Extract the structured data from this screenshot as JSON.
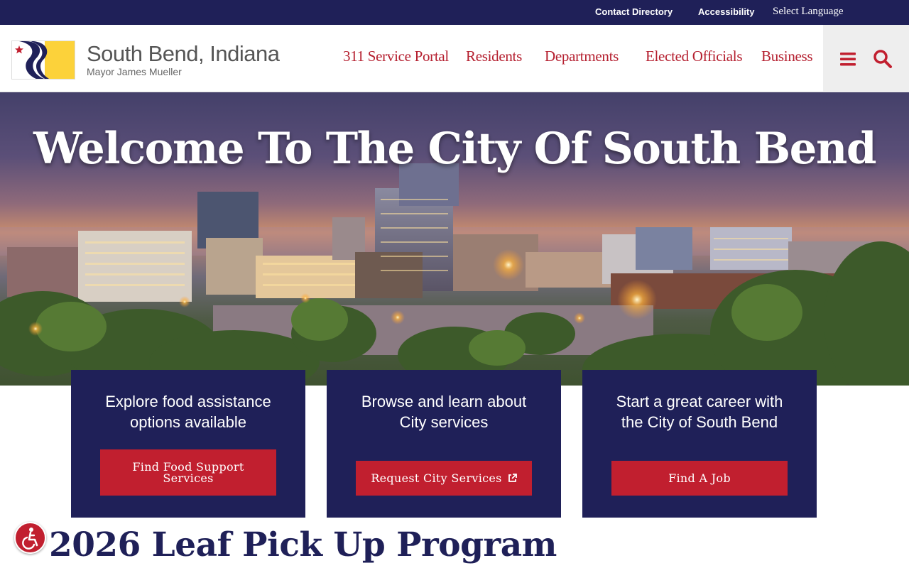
{
  "utility_bar": {
    "contact_directory": "Contact Directory",
    "accessibility": "Accessibility",
    "select_language": "Select Language"
  },
  "header": {
    "site_title": "South Bend, Indiana",
    "mayor": "Mayor James Mueller",
    "nav": [
      "311 Service Portal",
      "Residents",
      "Departments",
      "Elected Officials",
      "Business"
    ],
    "icons": {
      "menu": "hamburger-menu-icon",
      "search": "search-icon"
    }
  },
  "hero": {
    "title": "Welcome To The City Of South Bend"
  },
  "cards": [
    {
      "text_line1": "Explore food assistance",
      "text_line2": "options available",
      "button_line1": "Find Food Support",
      "button_line2": "Services"
    },
    {
      "text_line1": "Browse and learn about",
      "text_line2": "City services",
      "button": "Request City Services",
      "button_icon": "external-link-icon"
    },
    {
      "text_line1": "Start a great career with",
      "text_line2": "the City of South Bend",
      "button": "Find A Job"
    }
  ],
  "news": {
    "headline": "2026 Leaf Pick Up Program"
  },
  "colors": {
    "navy": "#1f2058",
    "red": "#c11f2f",
    "nav_red": "#b52030",
    "gold": "#fcd23a"
  }
}
